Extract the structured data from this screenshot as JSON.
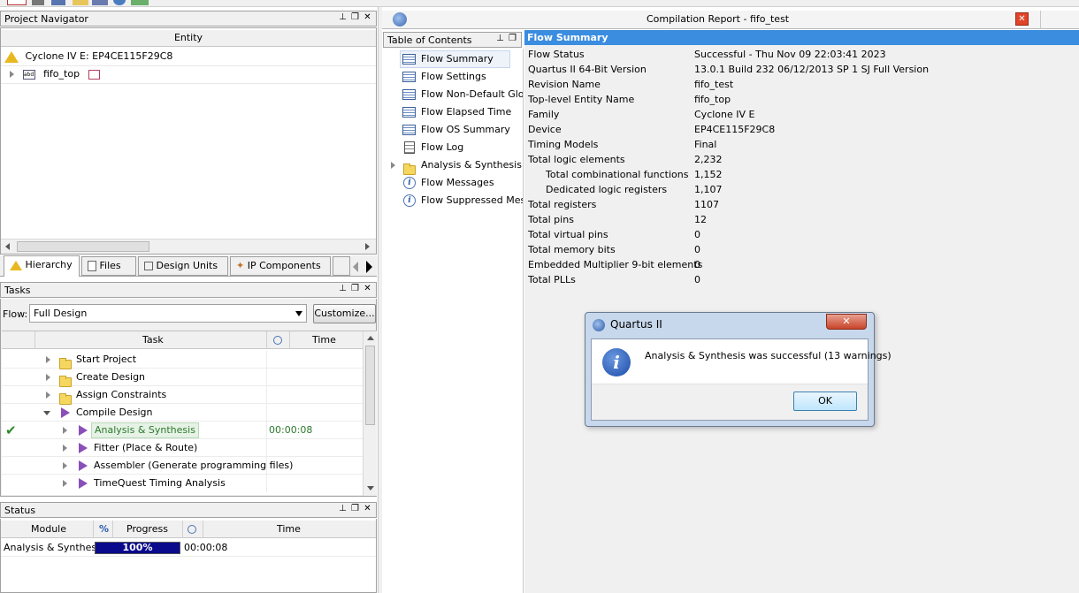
{
  "top_toolbar": {
    "icons": [
      "stop-icon",
      "compile-icon",
      "chip-icon",
      "folder-icon",
      "netlist-icon",
      "globe-icon",
      "check-icon"
    ]
  },
  "project_navigator": {
    "title": "Project Navigator",
    "column_header": "Entity",
    "device": "Cyclone IV E: EP4CE115F29C8",
    "top_entity": "fifo_top",
    "tabs": [
      "Hierarchy",
      "Files",
      "Design Units",
      "IP Components"
    ]
  },
  "tasks": {
    "title": "Tasks",
    "flow_label": "Flow:",
    "flow_value": "Full Design",
    "customize_label": "Customize...",
    "col_task": "Task",
    "col_time": "Time",
    "rows": [
      {
        "label": "Start Project",
        "time": ""
      },
      {
        "label": "Create Design",
        "time": ""
      },
      {
        "label": "Assign Constraints",
        "time": ""
      },
      {
        "label": "Compile Design",
        "time": ""
      },
      {
        "label": "Analysis & Synthesis",
        "time": "00:00:08"
      },
      {
        "label": "Fitter (Place & Route)",
        "time": ""
      },
      {
        "label": "Assembler (Generate programming files)",
        "time": ""
      },
      {
        "label": "TimeQuest Timing Analysis",
        "time": ""
      }
    ]
  },
  "status": {
    "title": "Status",
    "col_module": "Module",
    "col_progress_symbol": "%",
    "col_progress": "Progress",
    "col_time": "Time",
    "module": "Analysis & Synthesis",
    "progress_text": "100%",
    "progress_fraction": 1.0,
    "time": "00:00:08"
  },
  "report": {
    "title": "Compilation Report - fifo_test",
    "toc_title": "Table of Contents",
    "toc_items": [
      {
        "label": "Flow Summary",
        "icon": "table-icon"
      },
      {
        "label": "Flow Settings",
        "icon": "table-icon"
      },
      {
        "label": "Flow Non-Default Globa",
        "icon": "table-icon"
      },
      {
        "label": "Flow Elapsed Time",
        "icon": "table-icon"
      },
      {
        "label": "Flow OS Summary",
        "icon": "table-icon"
      },
      {
        "label": "Flow Log",
        "icon": "document-icon"
      },
      {
        "label": "Analysis & Synthesis",
        "icon": "folder-icon"
      },
      {
        "label": "Flow Messages",
        "icon": "info-icon"
      },
      {
        "label": "Flow Suppressed Messa",
        "icon": "info-icon"
      }
    ],
    "summary_header": "Flow Summary",
    "summary_rows": [
      {
        "key": "Flow Status",
        "value": "Successful - Thu Nov 09 22:03:41 2023"
      },
      {
        "key": "Quartus II 64-Bit Version",
        "value": "13.0.1 Build 232 06/12/2013 SP 1 SJ Full Version"
      },
      {
        "key": "Revision Name",
        "value": "fifo_test"
      },
      {
        "key": "Top-level Entity Name",
        "value": "fifo_top"
      },
      {
        "key": "Family",
        "value": "Cyclone IV E"
      },
      {
        "key": "Device",
        "value": "EP4CE115F29C8"
      },
      {
        "key": "Timing Models",
        "value": "Final"
      },
      {
        "key": "Total logic elements",
        "value": "2,232"
      },
      {
        "key": "Total combinational functions",
        "value": "1,152"
      },
      {
        "key": "Dedicated logic registers",
        "value": "1,107"
      },
      {
        "key": "Total registers",
        "value": "1107"
      },
      {
        "key": "Total pins",
        "value": "12"
      },
      {
        "key": "Total virtual pins",
        "value": "0"
      },
      {
        "key": "Total memory bits",
        "value": "0"
      },
      {
        "key": "Embedded Multiplier 9-bit elements",
        "value": "0"
      },
      {
        "key": "Total PLLs",
        "value": "0"
      }
    ]
  },
  "dialog": {
    "title": "Quartus II",
    "message": "Analysis & Synthesis was successful (13 warnings)",
    "ok_label": "OK"
  },
  "colors": {
    "accent": "#3b8de0",
    "progress": "#0a0a8c",
    "success": "#2c8a2c"
  }
}
